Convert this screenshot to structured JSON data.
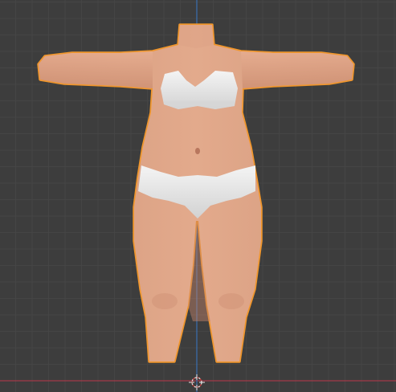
{
  "viewport": {
    "background_color": "#3d3d3d",
    "grid_minor_color": "#454545",
    "grid_major_color": "#4a4a4a",
    "x_axis_color": "#a33a48",
    "y_axis_color": "#3a6fb0",
    "origin_cursor_icon": "3d-cursor-icon"
  },
  "object": {
    "kind": "mesh",
    "description_icon": "human-body-mesh",
    "selected": true,
    "selection_outline_color": "#f0962c",
    "skin_color": "#e0a487",
    "skin_shadow_color": "#c7856a",
    "underwear_color": "#ececec",
    "underwear_shadow_color": "#c9c9c9"
  }
}
